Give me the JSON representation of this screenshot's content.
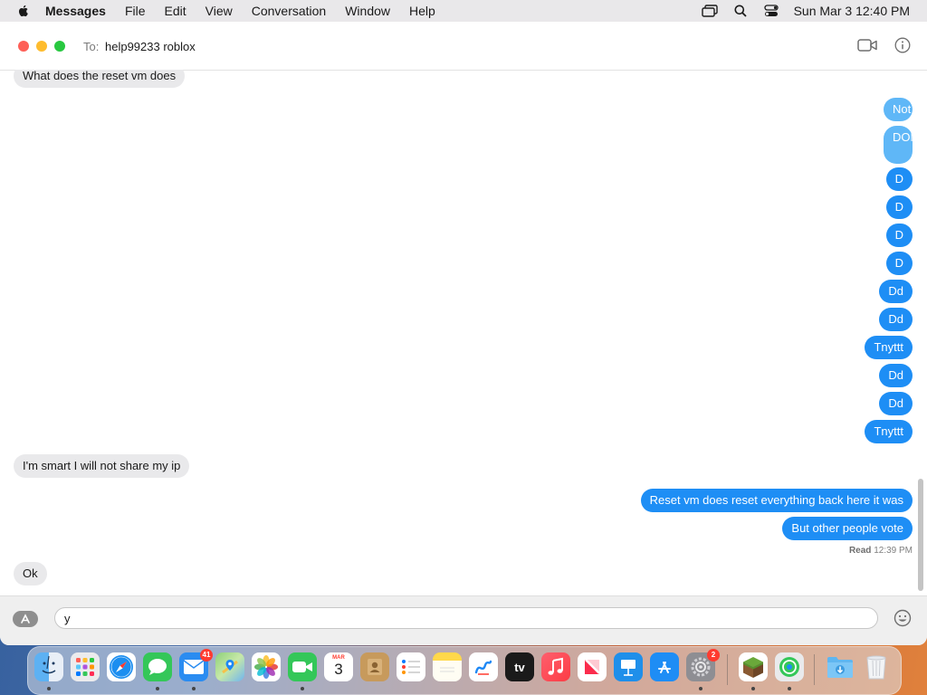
{
  "menubar": {
    "app_name": "Messages",
    "items": [
      "File",
      "Edit",
      "View",
      "Conversation",
      "Window",
      "Help"
    ],
    "clock": "Sun Mar 3  12:40 PM"
  },
  "window": {
    "to_label": "To:",
    "recipient": "help99233 roblox"
  },
  "messages": [
    {
      "dir": "in",
      "text": "What does the reset vm does"
    },
    {
      "dir": "out",
      "text": "Not till you drop th ip"
    },
    {
      "dir": "out",
      "text": "DONT"
    },
    {
      "dir": "out",
      "text": "D"
    },
    {
      "dir": "out",
      "text": "D"
    },
    {
      "dir": "out",
      "text": "D"
    },
    {
      "dir": "out",
      "text": "D"
    },
    {
      "dir": "out",
      "text": "Dd"
    },
    {
      "dir": "out",
      "text": "Dd"
    },
    {
      "dir": "out",
      "text": "Tnyttt"
    },
    {
      "dir": "out",
      "text": "Dd"
    },
    {
      "dir": "out",
      "text": "Dd"
    },
    {
      "dir": "out",
      "text": "Tnyttt"
    },
    {
      "dir": "in",
      "text": "I'm smart I will not share my ip"
    },
    {
      "dir": "out",
      "text": "Reset vm does reset everything back here it was"
    },
    {
      "dir": "out",
      "text": "But other people vote"
    },
    {
      "dir": "in",
      "text": "Ok"
    }
  ],
  "read_receipt": {
    "label": "Read",
    "time": "12:39 PM"
  },
  "input": {
    "value": "y"
  },
  "dock": {
    "calendar_month": "MAR",
    "calendar_day": "3",
    "mail_badge": "41",
    "settings_badge": "2",
    "tv_label": "tv",
    "apps": [
      "finder",
      "launchpad",
      "safari",
      "messages",
      "mail",
      "maps",
      "photos",
      "facetime",
      "calendar",
      "contacts",
      "reminders",
      "notes",
      "freeform",
      "apple-tv",
      "music",
      "news",
      "keynote",
      "app-store",
      "system-settings",
      "minecraft",
      "find-my",
      "downloads",
      "trash"
    ]
  },
  "colors": {
    "outgoing_bubble": "#1e8ef5",
    "incoming_bubble": "#e9e9eb",
    "close": "#fe5f57",
    "minimize": "#febc2e",
    "zoom": "#28c840"
  }
}
